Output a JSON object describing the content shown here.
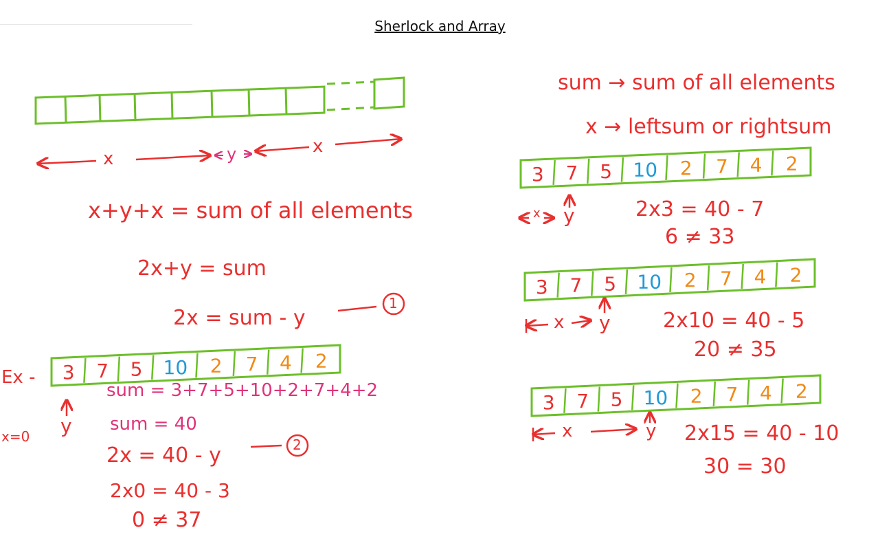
{
  "title": "Sherlock and Array",
  "left": {
    "arrow_x1": "x",
    "arrow_y": "y",
    "arrow_x2": "x",
    "eq1": "x+y+x = sum of all elements",
    "eq2": "2x+y = sum",
    "eq3": "2x = sum - y",
    "eq3_tag": "1",
    "ex_label": "Ex -",
    "example_array": [
      "3",
      "7",
      "5",
      "10",
      "2",
      "7",
      "4",
      "2"
    ],
    "y_label": "y",
    "x_zero": "x=0",
    "sum_expr": "sum = 3+7+5+10+2+7+4+2",
    "sum_val": "sum = 40",
    "eq4": "2x = 40 - y",
    "eq4_tag": "2",
    "calc1": "2x0 = 40 - 3",
    "calc2": "0 ≠ 37"
  },
  "right": {
    "note1": "sum → sum of all elements",
    "note2": "x → leftsum or rightsum",
    "cases": [
      {
        "array": [
          "3",
          "7",
          "5",
          "10",
          "2",
          "7",
          "4",
          "2"
        ],
        "x_label": "x",
        "y_label": "y",
        "calc1": "2x3 = 40 - 7",
        "calc2": "6 ≠ 33"
      },
      {
        "array": [
          "3",
          "7",
          "5",
          "10",
          "2",
          "7",
          "4",
          "2"
        ],
        "x_label": "x",
        "y_label": "y",
        "calc1": "2x10 = 40 - 5",
        "calc2": "20 ≠ 35"
      },
      {
        "array": [
          "3",
          "7",
          "5",
          "10",
          "2",
          "7",
          "4",
          "2"
        ],
        "x_label": "x",
        "y_label": "y",
        "calc1": "2x15 = 40 - 10",
        "calc2": "30 = 30"
      }
    ]
  },
  "colors": {
    "ink_red": "#e8302f",
    "ink_pink": "#e0337a",
    "box_green": "#6cbf2a",
    "num_blue": "#1f9ad6",
    "num_orange": "#f08a16",
    "num_red": "#e8302f"
  },
  "cell_colors": [
    "red",
    "red",
    "red",
    "blue",
    "orange",
    "orange",
    "orange",
    "orange"
  ]
}
